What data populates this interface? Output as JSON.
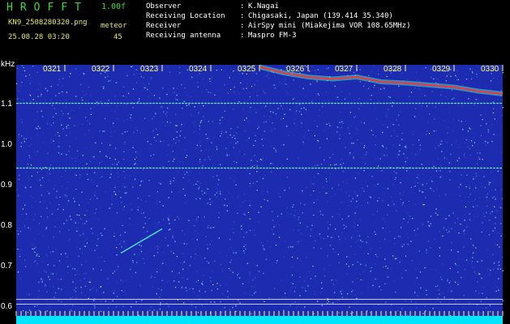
{
  "header": {
    "app_title": "HROFFT",
    "version": "1.00f",
    "file_name": "KN9_2508280320.png",
    "timestamp": "25.08.28 03:20",
    "meteor_label": "meteor",
    "meteor_count": "45"
  },
  "info": {
    "rows": [
      {
        "label": "Observer",
        "colon": ":",
        "value": "K.Nagai"
      },
      {
        "label": "Receiving Location",
        "colon": ":",
        "value": "Chigasaki, Japan (139.414 35.340)"
      },
      {
        "label": "Receiver",
        "colon": ":",
        "value": "AirSpy mini (Miakejima VOR 108.65MHz)"
      },
      {
        "label": "Receiving antenna",
        "colon": ":",
        "value": "Maspro FM-3"
      }
    ]
  },
  "colors": {
    "background": "#000000",
    "plot_background": "#1d2bb0",
    "title_green": "#33dd33",
    "header_yellow": "#e8e860",
    "tick_yellow": "#ffff66",
    "trace_red": "#ff3030",
    "floor_cyan": "#00e5ff"
  },
  "chart_data": {
    "type": "heatmap",
    "unit_label": "kHz",
    "y_ticks": [
      "1.1",
      "1.0",
      "0.9",
      "0.8",
      "0.7",
      "0.6"
    ],
    "y_tick_values": [
      1.1,
      1.0,
      0.9,
      0.8,
      0.7,
      0.6
    ],
    "ylim": [
      0.58,
      1.2
    ],
    "x_ticks": [
      "0321",
      "0322",
      "0323",
      "0324",
      "0325",
      "0326",
      "0327",
      "0328",
      "0329",
      "0330"
    ],
    "xlim": [
      0,
      10
    ],
    "carrier_lines_khz": [
      1.105,
      0.945
    ],
    "reference_lines_khz": [
      0.621,
      0.609
    ],
    "red_trace": {
      "x": [
        5.0,
        5.5,
        6.0,
        6.5,
        7.0,
        7.5,
        8.0,
        8.5,
        9.0,
        9.5,
        10.0
      ],
      "y": [
        1.195,
        1.18,
        1.17,
        1.165,
        1.17,
        1.158,
        1.155,
        1.15,
        1.145,
        1.135,
        1.128
      ]
    },
    "meteor_streak": {
      "x": [
        2.15,
        3.0
      ],
      "y": [
        0.735,
        0.795
      ]
    }
  }
}
